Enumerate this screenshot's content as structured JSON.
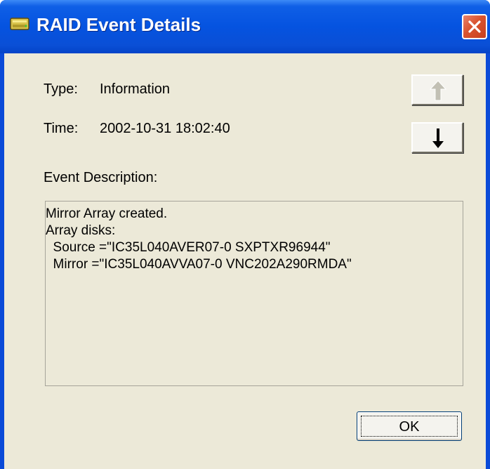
{
  "window": {
    "title": "RAID Event Details",
    "icon": "raid-drive-icon",
    "close_icon": "close-icon"
  },
  "fields": {
    "type_label": "Type:",
    "type_value": "Information",
    "time_label": "Time:",
    "time_value": "2002-10-31 18:02:40"
  },
  "navigation": {
    "previous_icon": "arrow-up-icon",
    "previous_enabled": false,
    "next_icon": "arrow-down-icon",
    "next_enabled": true
  },
  "description": {
    "label": "Event Description:",
    "lines": [
      "Mirror Array created.",
      "Array disks:",
      "  Source =\"IC35L040AVER07-0 SXPTXR96944\"",
      "  Mirror =\"IC35L040AVVA07-0 VNC202A290RMDA\""
    ]
  },
  "buttons": {
    "ok_label": "OK"
  },
  "colors": {
    "titlebar": "#0553e0",
    "close_button": "#d9532f",
    "dialog_background": "#ece9d8"
  }
}
